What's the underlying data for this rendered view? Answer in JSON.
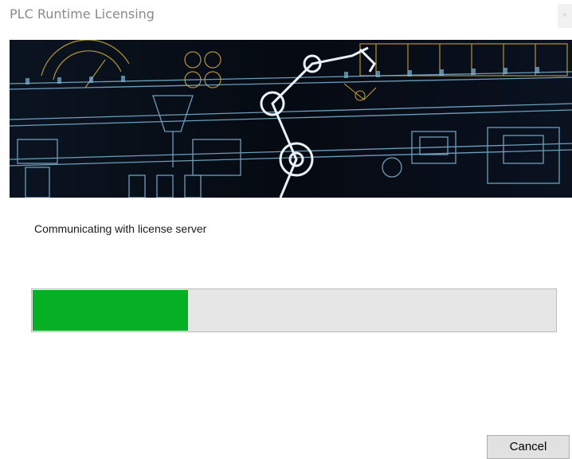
{
  "window": {
    "title": "PLC Runtime Licensing",
    "close_label": "×"
  },
  "banner": {
    "description_icon": "industrial-automation-banner"
  },
  "status": {
    "message": "Communicating with license server"
  },
  "progress": {
    "value_percent": 30,
    "fill_color": "#06b025",
    "track_color": "#e6e6e6"
  },
  "buttons": {
    "cancel_label": "Cancel"
  }
}
